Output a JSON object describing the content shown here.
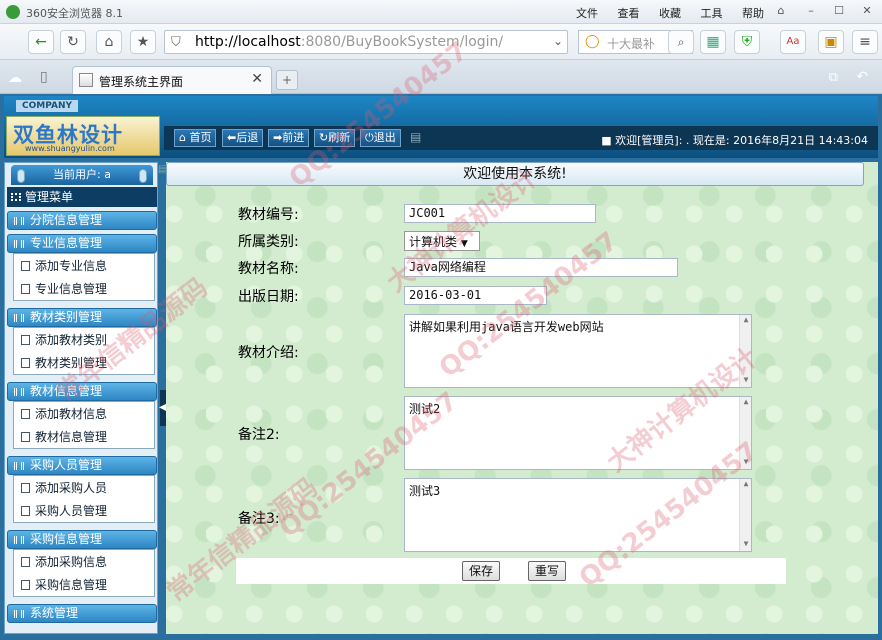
{
  "browser": {
    "app_title": "360安全浏览器 8.1",
    "menu": [
      "文件",
      "查看",
      "收藏",
      "工具",
      "帮助"
    ],
    "url_host": "http://localhost",
    "url_path": ":8080/BuyBookSystem/login/",
    "search_placeholder": "十大最补",
    "tab_label": "管理系统主界面",
    "new_tab": "+"
  },
  "header": {
    "company": "COMPANY",
    "logo_text": "双鱼林设计",
    "logo_url": "www.shuangyulin.com",
    "toolbar": [
      "首页",
      "后退",
      "前进",
      "刷新",
      "退出"
    ],
    "welcome": "■ 欢迎[管理员]: . 现在是: 2016年8月21日 14:43:04"
  },
  "sidebar": {
    "current_user": "当前用户: a",
    "menu_title": "管理菜单",
    "groups": [
      {
        "label": "分院信息管理",
        "items": []
      },
      {
        "label": "专业信息管理",
        "items": [
          "添加专业信息",
          "专业信息管理"
        ]
      },
      {
        "label": "教材类别管理",
        "items": [
          "添加教材类别",
          "教材类别管理"
        ]
      },
      {
        "label": "教材信息管理",
        "items": [
          "添加教材信息",
          "教材信息管理"
        ]
      },
      {
        "label": "采购人员管理",
        "items": [
          "添加采购人员",
          "采购人员管理"
        ]
      },
      {
        "label": "采购信息管理",
        "items": [
          "添加采购信息",
          "采购信息管理"
        ]
      },
      {
        "label": "系统管理",
        "items": []
      }
    ]
  },
  "main": {
    "title": "欢迎使用本系统!",
    "form": {
      "code_label": "教材编号:",
      "code_value": "JC001",
      "category_label": "所属类别:",
      "category_value": "计算机类",
      "name_label": "教材名称:",
      "name_value": "Java网络编程",
      "date_label": "出版日期:",
      "date_value": "2016-03-01",
      "intro_label": "教材介绍:",
      "intro_value": "讲解如果利用java语言开发web网站",
      "note2_label": "备注2:",
      "note2_value": "测试2",
      "note3_label": "备注3:",
      "note3_value": "测试3",
      "save_label": "保存",
      "reset_label": "重写"
    }
  },
  "watermarks": [
    "QQ:254540457",
    "大神计算机设计",
    "常年信精品源码",
    "QQ:254540457",
    "大神计算机设计",
    "常年信精品源码",
    "QQ:254540457",
    "QQ:254540457"
  ]
}
